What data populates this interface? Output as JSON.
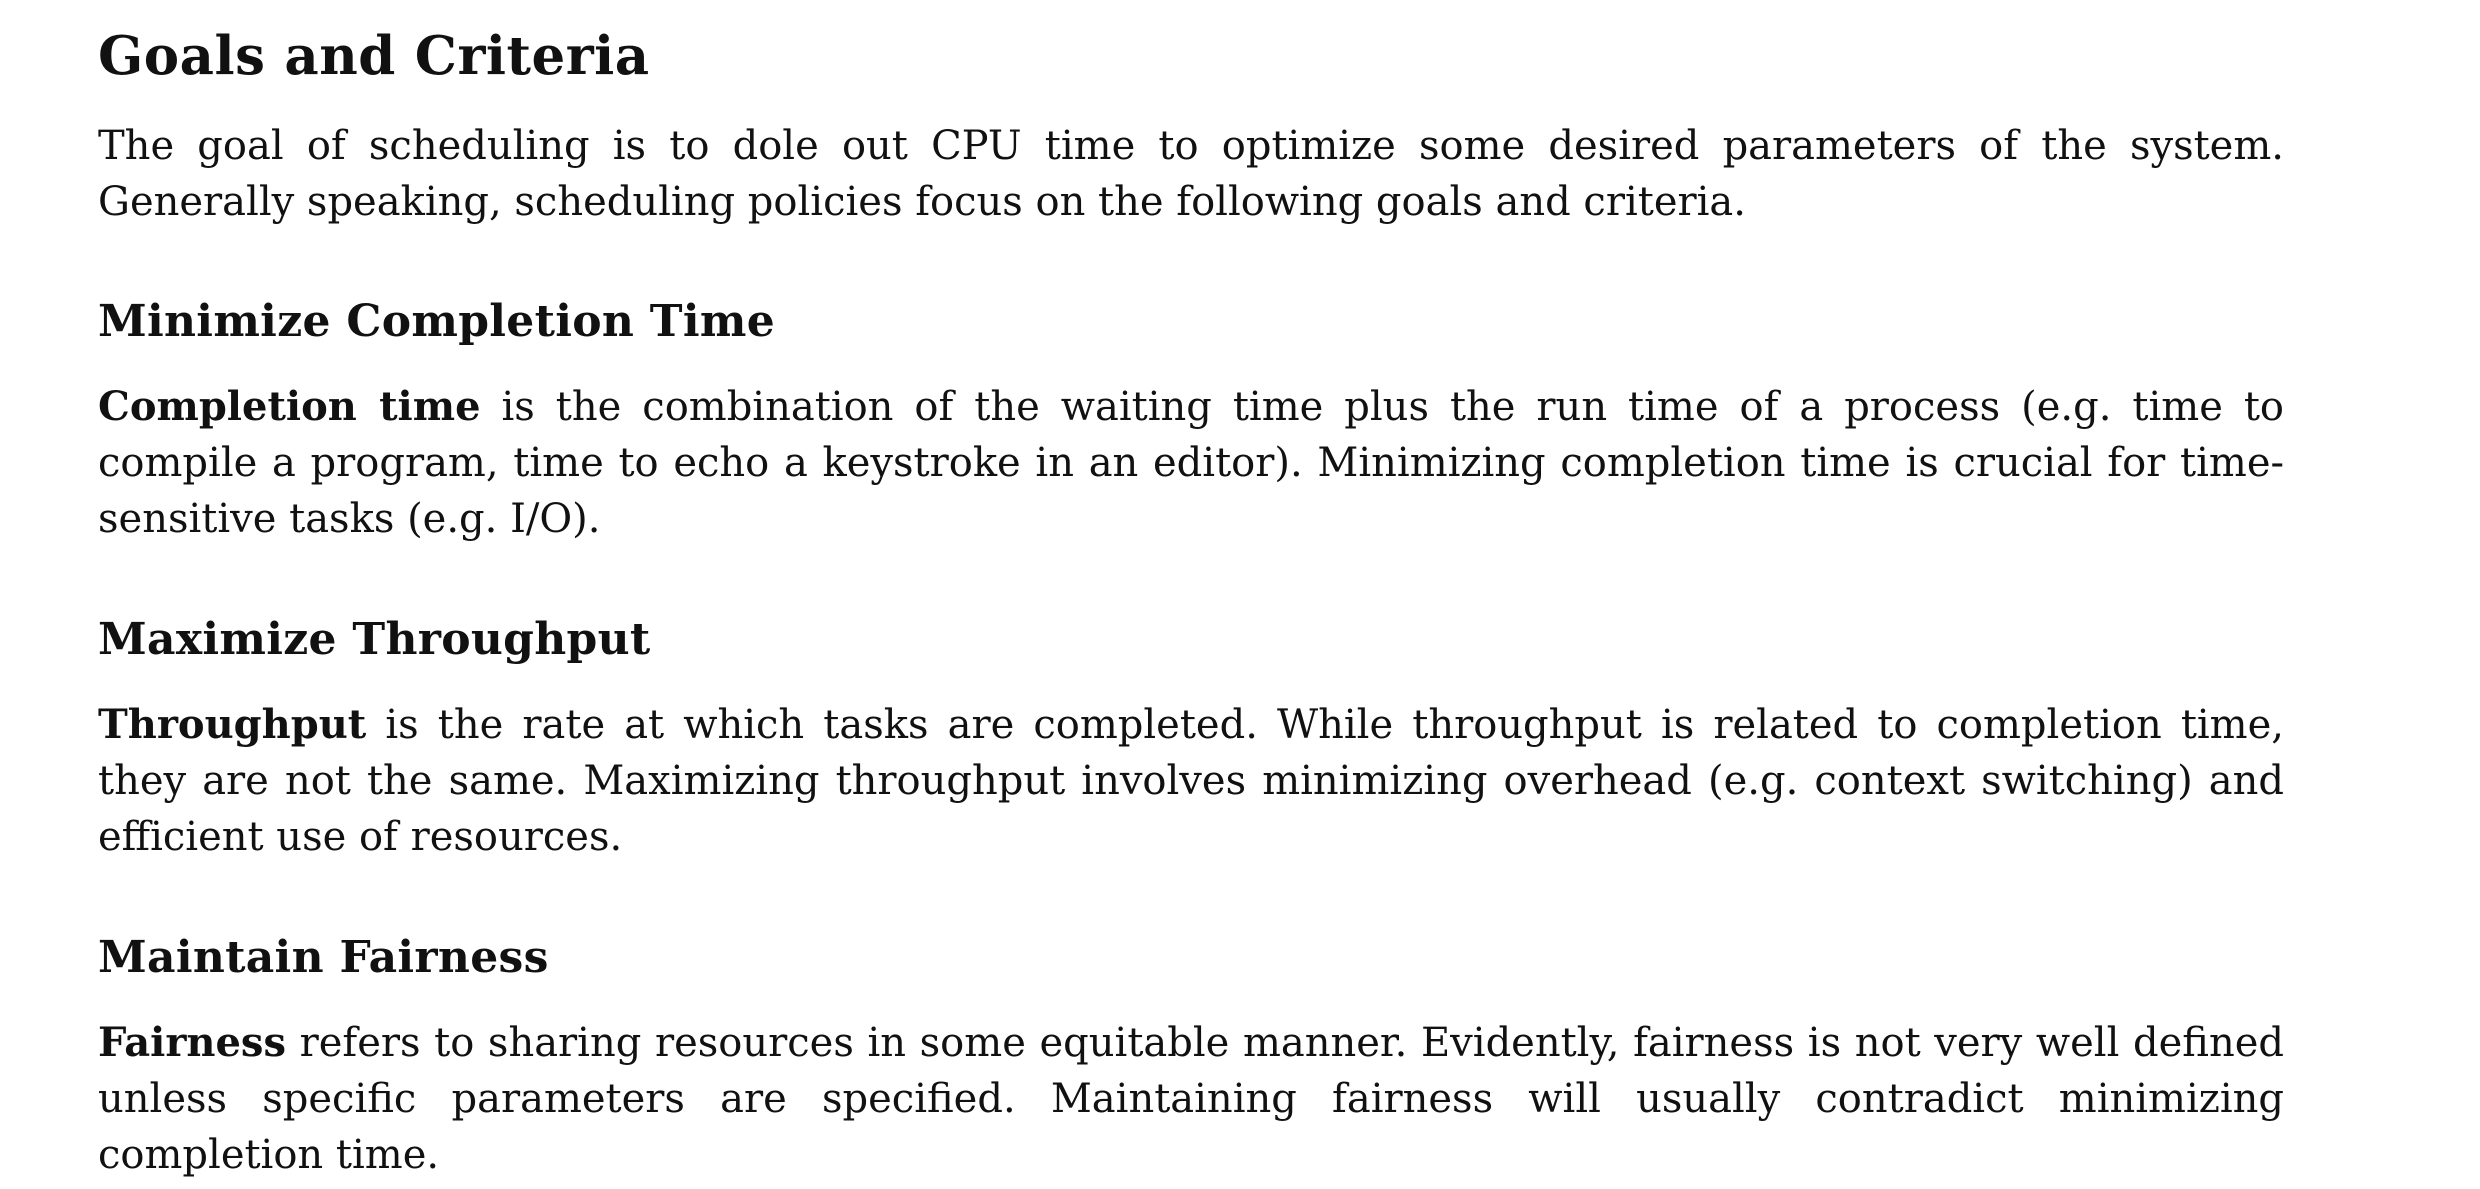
{
  "section": {
    "title": "Goals and Criteria",
    "intro": "The goal of scheduling is to dole out CPU time to optimize some desired parameters of the system. Generally speaking, scheduling policies focus on the following goals and criteria."
  },
  "subsections": [
    {
      "title": "Minimize Completion Time",
      "term": "Completion time",
      "body": " is the combination of the waiting time plus the run time of a process (e.g. time to compile a program, time to echo a keystroke in an editor). Minimizing completion time is crucial for time-sensitive tasks (e.g. I/O)."
    },
    {
      "title": "Maximize Throughput",
      "term": "Throughput",
      "body": " is the rate at which tasks are completed. While throughput is related to completion time, they are not the same. Maximizing throughput involves minimizing overhead (e.g. context switching) and efficient use of resources."
    },
    {
      "title": "Maintain Fairness",
      "term": "Fairness",
      "body": " refers to sharing resources in some equitable manner. Evidently, fairness is not very well defined unless specific parameters are specified. Maintaining fairness will usually contradict minimizing completion time."
    }
  ]
}
